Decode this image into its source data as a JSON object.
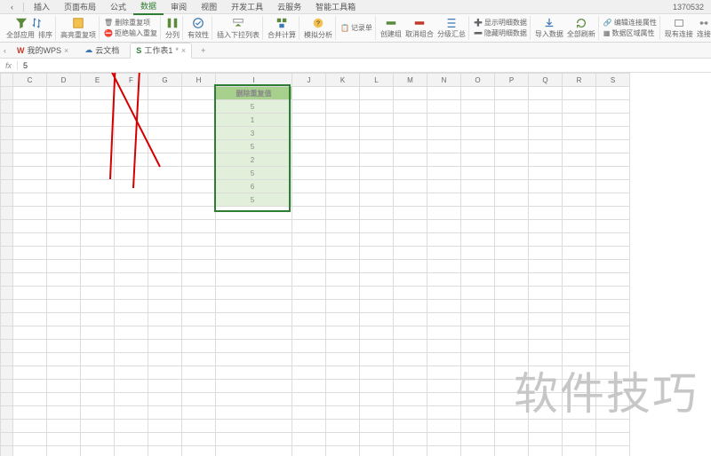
{
  "menu": {
    "items": [
      "插入",
      "页面布局",
      "公式",
      "数据",
      "审阅",
      "视图",
      "开发工具",
      "云服务",
      "智能工具箱"
    ],
    "active_index": 3
  },
  "user_number": "1370532",
  "ribbon": {
    "g1": {
      "lbl1": "全部应用",
      "lbl2": "排序"
    },
    "g2": {
      "lbl": "高亮重复项"
    },
    "g3": {
      "l1": "删除重复项",
      "l2": "拒绝输入重复"
    },
    "g4": {
      "lbl": "分列"
    },
    "g5": {
      "lbl": "有效性"
    },
    "g6": {
      "lbl": "插入下拉列表"
    },
    "g7": {
      "lbl": "合并计算"
    },
    "g8": {
      "lbl": "模拟分析"
    },
    "g9": {
      "l1": "记录单",
      "l2": ""
    },
    "g10": {
      "l1": "创建组",
      "l2": "取消组合",
      "l3": "分级汇总"
    },
    "g11": {
      "l1": "显示明细数据",
      "l2": "隐藏明细数据"
    },
    "g12": {
      "l1": "导入数据",
      "l2": "全部刷新"
    },
    "g13": {
      "l1": "编辑连接属性",
      "l2": "数据区域属性"
    },
    "g14": {
      "l1": "现有连接",
      "l2": "连接"
    }
  },
  "doc_tabs": {
    "t1": "我的WPS",
    "t2": "云文档",
    "t3": "工作表1"
  },
  "formula": {
    "fx": "fx",
    "value": "5"
  },
  "columns": [
    "",
    "C",
    "D",
    "E",
    "F",
    "G",
    "H",
    "I",
    "J",
    "K",
    "L",
    "M",
    "N",
    "O",
    "P",
    "Q",
    "R",
    "S"
  ],
  "chart_data": {
    "type": "table",
    "title": "删除重复值",
    "header": "删除重复值",
    "values": [
      5,
      1,
      3,
      5,
      2,
      5,
      6,
      5
    ],
    "col": "I",
    "start_row": 1
  },
  "watermark": "软件技巧"
}
